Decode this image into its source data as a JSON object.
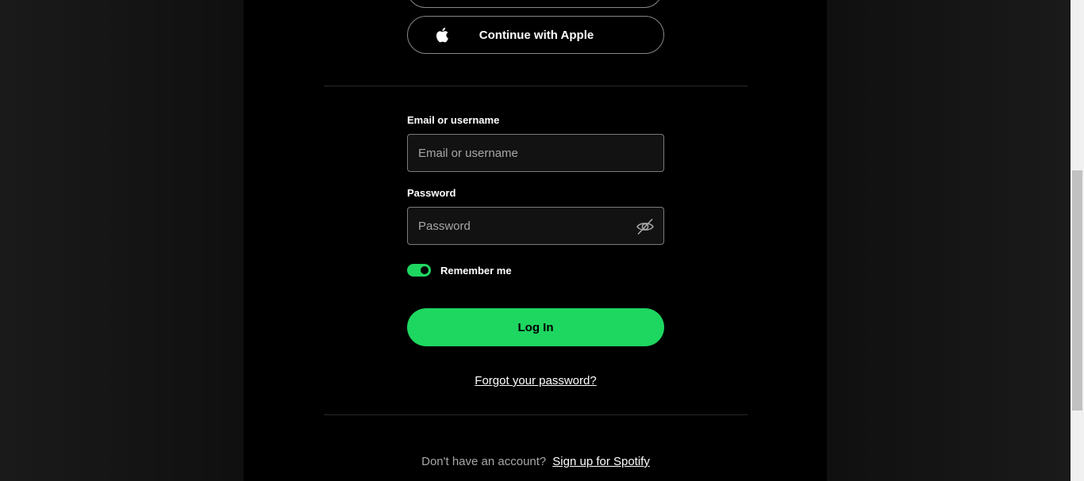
{
  "apple_button": {
    "label": "Continue with Apple",
    "icon": "apple-icon"
  },
  "form": {
    "email_label": "Email or username",
    "email_placeholder": "Email or username",
    "email_value": "",
    "password_label": "Password",
    "password_placeholder": "Password",
    "password_value": "",
    "password_toggle_icon": "eye-off-icon",
    "remember_label": "Remember me",
    "remember_checked": true,
    "login_label": "Log In",
    "forgot_label": "Forgot your password?"
  },
  "footer": {
    "prompt": "Don't have an account?",
    "signup_label": "Sign up for Spotify"
  },
  "colors": {
    "accent": "#1ed760",
    "background": "#000000",
    "text": "#ffffff",
    "muted": "#a7a7a7"
  }
}
